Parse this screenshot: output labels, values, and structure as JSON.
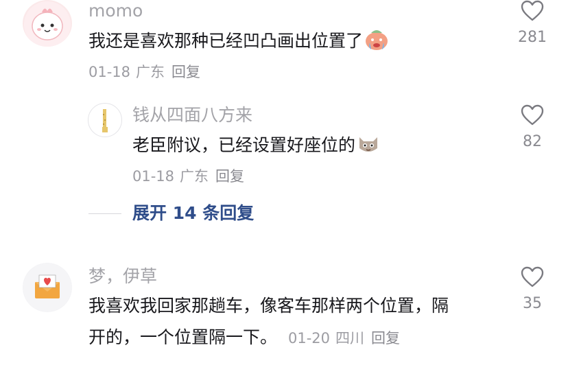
{
  "comments": [
    {
      "username": "momo",
      "text": "我还是喜欢那种已经凹凸画出位置了",
      "date": "01-18",
      "location": "广东",
      "reply_label": "回复",
      "likes": "281"
    },
    {
      "username": "钱从四面八方来",
      "text": "老臣附议，已经设置好座位的",
      "date": "01-18",
      "location": "广东",
      "reply_label": "回复",
      "likes": "82"
    },
    {
      "username": "梦，伊草",
      "text_line1": "我喜欢我回家那趟车，像客车那样两个位置，隔",
      "text_line2": "开的，一个位置隔一下。",
      "date": "01-20",
      "location": "四川",
      "reply_label": "回复",
      "likes": "35"
    }
  ],
  "expand_replies": "展开 14 条回复",
  "colors": {
    "link": "#2f4d8a",
    "text": "#18181c",
    "muted": "#a3a3a8"
  }
}
